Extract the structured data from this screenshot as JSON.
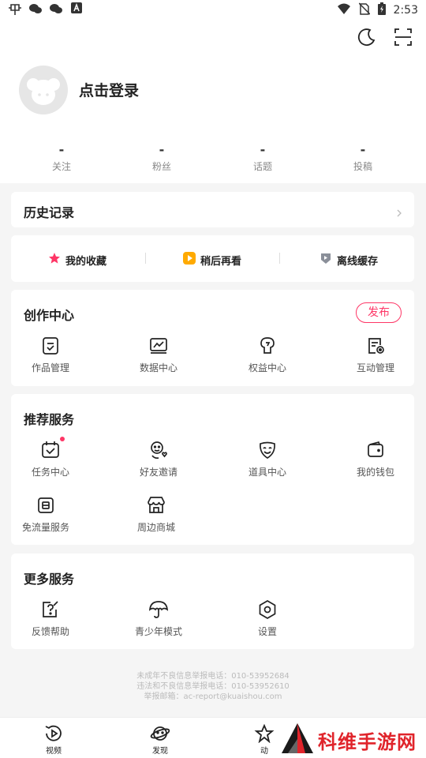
{
  "status_bar": {
    "time": "2:53",
    "left_icons": [
      "bug-icon",
      "wechat-icon",
      "wechat-icon",
      "a-icon"
    ],
    "right_icons": [
      "wifi-icon",
      "no-sim-icon",
      "battery-icon"
    ]
  },
  "header": {
    "theme_icon": "moon-icon",
    "scan_icon": "scan-icon"
  },
  "profile": {
    "login_label": "点击登录"
  },
  "stats": [
    {
      "value": "-",
      "label": "关注"
    },
    {
      "value": "-",
      "label": "粉丝"
    },
    {
      "value": "-",
      "label": "话题"
    },
    {
      "value": "-",
      "label": "投稿"
    }
  ],
  "history": {
    "title": "历史记录"
  },
  "quick_links": [
    {
      "label": "我的收藏",
      "icon": "star-icon",
      "color": "#fe3666"
    },
    {
      "label": "稍后再看",
      "icon": "watch-later-icon",
      "color": "#ffaa00"
    },
    {
      "label": "离线缓存",
      "icon": "download-icon",
      "color": "#8a8f99"
    }
  ],
  "creation": {
    "title": "创作中心",
    "publish_label": "发布",
    "items": [
      {
        "label": "作品管理",
        "icon": "works-icon"
      },
      {
        "label": "数据中心",
        "icon": "data-chart-icon"
      },
      {
        "label": "权益中心",
        "icon": "rights-icon"
      },
      {
        "label": "互动管理",
        "icon": "interaction-icon"
      }
    ]
  },
  "recommended": {
    "title": "推荐服务",
    "items": [
      {
        "label": "任务中心",
        "icon": "task-calendar-icon"
      },
      {
        "label": "好友邀请",
        "icon": "invite-friend-icon"
      },
      {
        "label": "道具中心",
        "icon": "props-mask-icon"
      },
      {
        "label": "我的钱包",
        "icon": "wallet-icon"
      },
      {
        "label": "免流量服务",
        "icon": "sim-card-icon"
      },
      {
        "label": "周边商城",
        "icon": "shop-icon"
      }
    ]
  },
  "more": {
    "title": "更多服务",
    "items": [
      {
        "label": "反馈帮助",
        "icon": "help-icon"
      },
      {
        "label": "青少年模式",
        "icon": "umbrella-icon"
      },
      {
        "label": "设置",
        "icon": "settings-icon"
      }
    ]
  },
  "footer": {
    "line1": "未成年不良信息举报电话：010-53952684",
    "line2": "违法和不良信息举报电话：010-53952610",
    "line3": "举报邮箱：ac-report@kuaishou.com"
  },
  "tabs": [
    {
      "label": "视频",
      "icon": "video-tab-icon"
    },
    {
      "label": "发现",
      "icon": "planet-tab-icon"
    },
    {
      "label": "动",
      "icon": "dynamic-tab-icon"
    }
  ],
  "watermark": {
    "text": "科维手游网"
  },
  "colors": {
    "accent": "#fe3666",
    "background": "#f5f5f5",
    "card": "#ffffff"
  }
}
